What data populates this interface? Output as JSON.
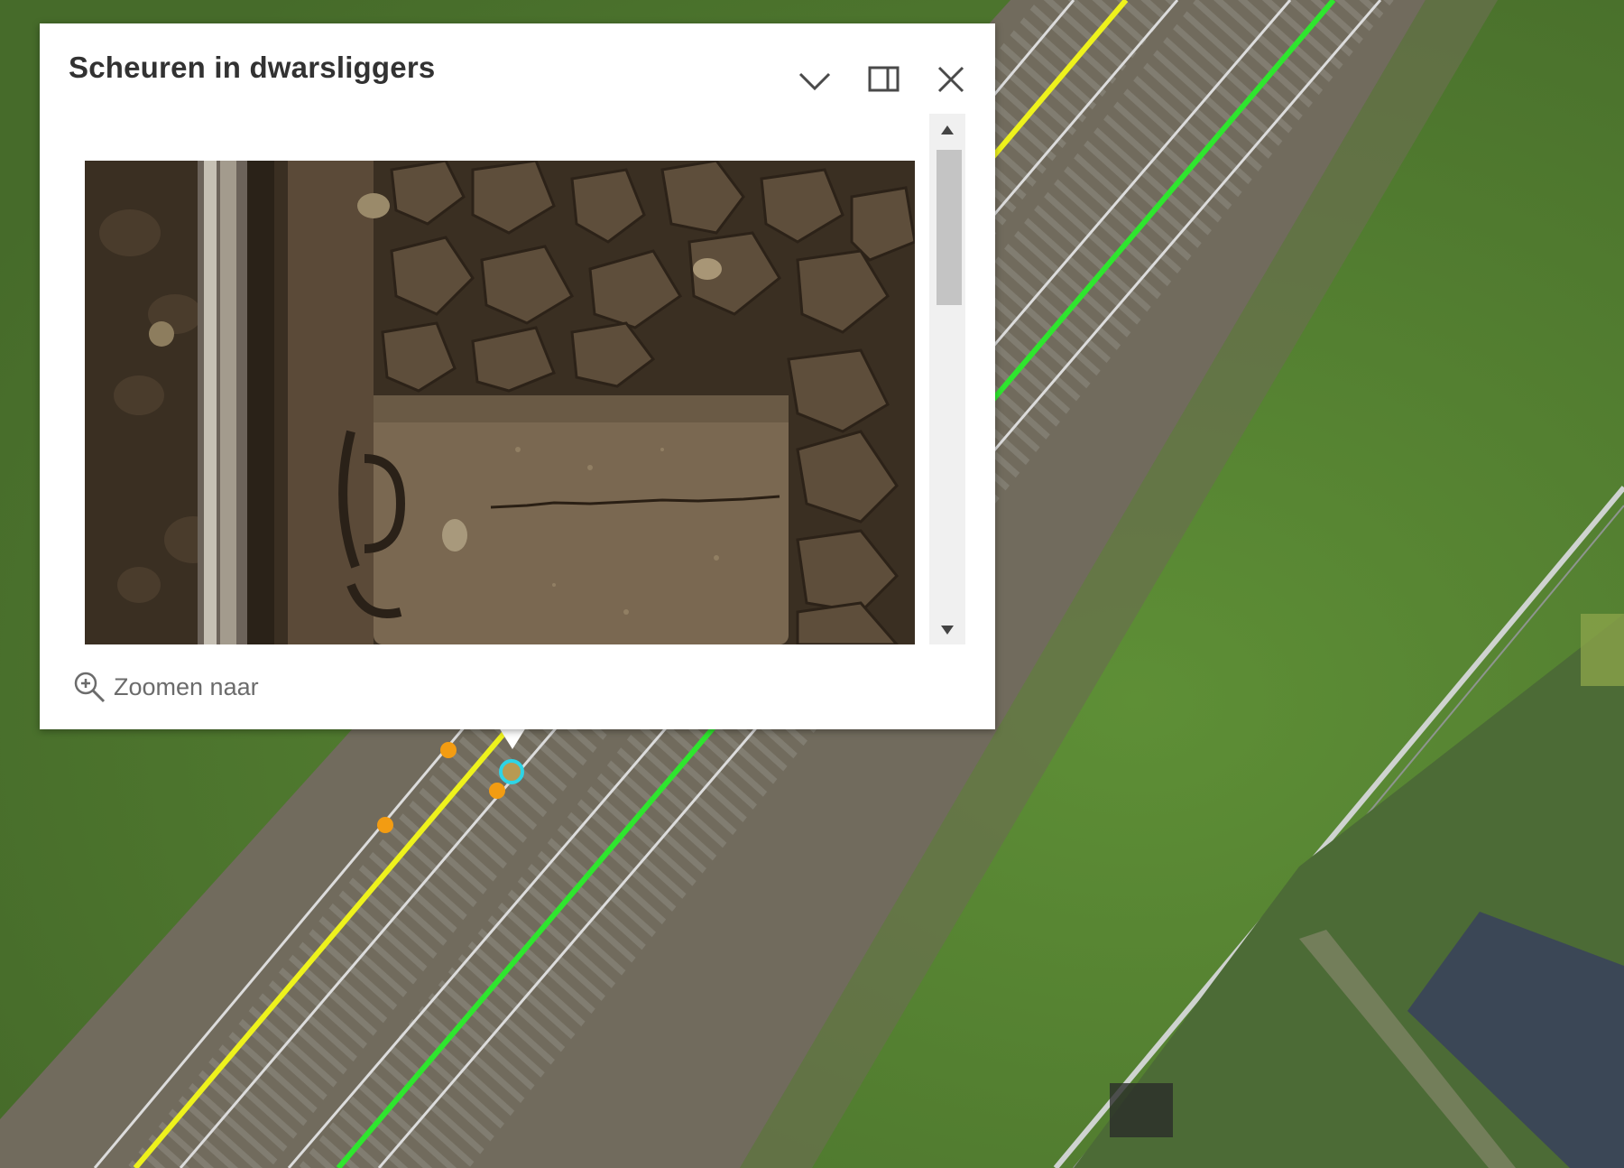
{
  "popup": {
    "title": "Scheuren in dwarsliggers",
    "actions": {
      "zoom_to_label": "Zoomen naar"
    },
    "header_buttons": [
      "chevron-down-icon",
      "dock-icon",
      "close-icon"
    ]
  },
  "colors": {
    "grass": "#5f8a34",
    "ballast": "#6f6a5e",
    "rail": "#d8d8d8",
    "track_line_yellow": "#f2f21a",
    "track_line_green": "#2de82d",
    "feature_point": "#f39c12",
    "selected_point": "#2ed4e6",
    "popup_bg": "#ffffff",
    "title_text": "#323232"
  },
  "icons": {
    "zoom": "zoom-in-icon",
    "scroll_up": "triangle-up-icon",
    "scroll_down": "triangle-down-icon"
  }
}
